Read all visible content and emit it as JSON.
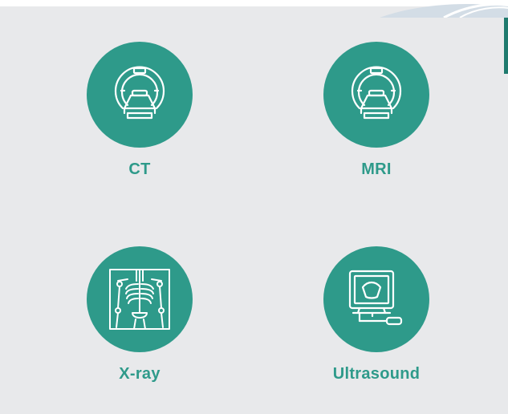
{
  "modalities": [
    {
      "label": "CT",
      "icon": "ct-scanner-icon"
    },
    {
      "label": "MRI",
      "icon": "mri-scanner-icon"
    },
    {
      "label": "X-ray",
      "icon": "xray-skeleton-icon"
    },
    {
      "label": "Ultrasound",
      "icon": "ultrasound-monitor-icon"
    }
  ],
  "colors": {
    "accent": "#2e9a8a",
    "background": "#e8e9eb",
    "icon_stroke": "#ffffff"
  }
}
